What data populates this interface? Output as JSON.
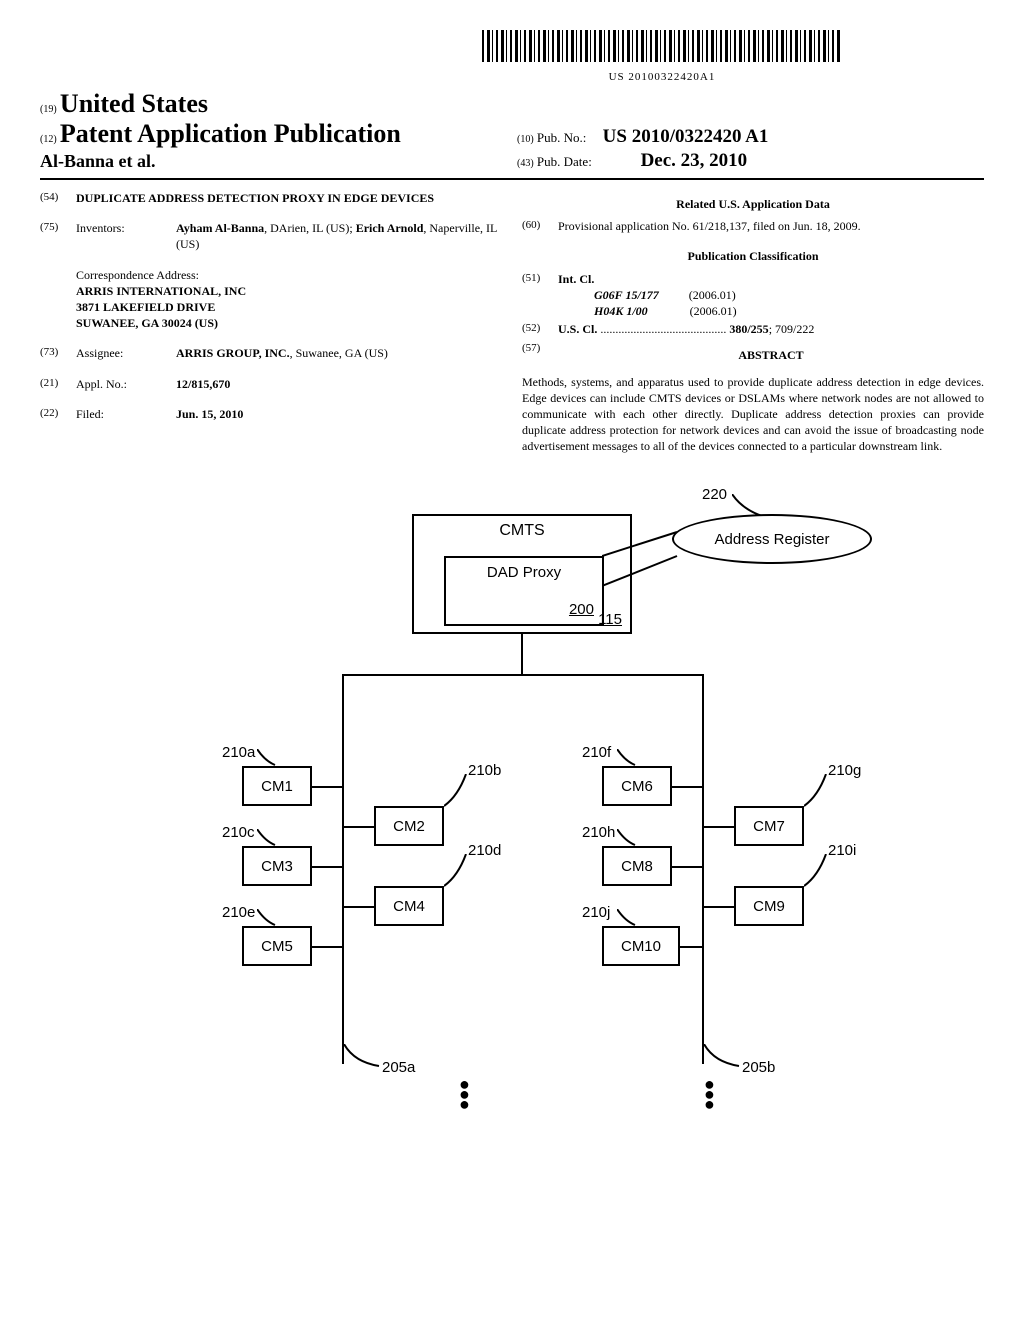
{
  "barcode_text": "US 20100322420A1",
  "header": {
    "country_code": "(19)",
    "country": "United States",
    "pub_type_code": "(12)",
    "pub_type": "Patent Application Publication",
    "authors": "Al-Banna et al.",
    "pub_no_code": "(10)",
    "pub_no_label": "Pub. No.:",
    "pub_no": "US 2010/0322420 A1",
    "pub_date_code": "(43)",
    "pub_date_label": "Pub. Date:",
    "pub_date": "Dec. 23, 2010"
  },
  "left": {
    "title_code": "(54)",
    "title": "DUPLICATE ADDRESS DETECTION PROXY IN EDGE DEVICES",
    "inventors_code": "(75)",
    "inventors_label": "Inventors:",
    "inventors_value_1": "Ayham Al-Banna",
    "inventors_value_1_loc": ", DArien, IL (US); ",
    "inventors_value_2": "Erich Arnold",
    "inventors_value_2_loc": ", Naperville, IL (US)",
    "corr_label": "Correspondence Address:",
    "corr_1": "ARRIS INTERNATIONAL, INC",
    "corr_2": "3871 LAKEFIELD DRIVE",
    "corr_3": "SUWANEE, GA 30024 (US)",
    "assignee_code": "(73)",
    "assignee_label": "Assignee:",
    "assignee_value": "ARRIS GROUP, INC.",
    "assignee_loc": ", Suwanee, GA (US)",
    "appl_code": "(21)",
    "appl_label": "Appl. No.:",
    "appl_value": "12/815,670",
    "filed_code": "(22)",
    "filed_label": "Filed:",
    "filed_value": "Jun. 15, 2010"
  },
  "right": {
    "related_heading": "Related U.S. Application Data",
    "provisional_code": "(60)",
    "provisional_text": "Provisional application No. 61/218,137, filed on Jun. 18, 2009.",
    "class_heading": "Publication Classification",
    "intcl_code": "(51)",
    "intcl_label": "Int. Cl.",
    "intcl_1_sym": "G06F 15/177",
    "intcl_1_ver": "(2006.01)",
    "intcl_2_sym": "H04K 1/00",
    "intcl_2_ver": "(2006.01)",
    "uscl_code": "(52)",
    "uscl_label": "U.S. Cl.",
    "uscl_dots": "..........................................",
    "uscl_value_bold": "380/255",
    "uscl_value_rest": "; 709/222",
    "abstract_code": "(57)",
    "abstract_label": "ABSTRACT",
    "abstract_text": "Methods, systems, and apparatus used to provide duplicate address detection in edge devices. Edge devices can include CMTS devices or DSLAMs where network nodes are not allowed to communicate with each other directly. Duplicate address detection proxies can provide duplicate address protection for network devices and can avoid the issue of broadcasting node advertisement messages to all of the devices connected to a particular downstream link."
  },
  "diagram": {
    "cmts": "CMTS",
    "dad": "DAD Proxy",
    "dad_num": "200",
    "cmts_num": "115",
    "register": "Address Register",
    "register_ref": "220",
    "bus_a_ref": "205a",
    "bus_b_ref": "205b",
    "cm": {
      "a": {
        "label": "CM1",
        "ref": "210a"
      },
      "b": {
        "label": "CM2",
        "ref": "210b"
      },
      "c": {
        "label": "CM3",
        "ref": "210c"
      },
      "d": {
        "label": "CM4",
        "ref": "210d"
      },
      "e": {
        "label": "CM5",
        "ref": "210e"
      },
      "f": {
        "label": "CM6",
        "ref": "210f"
      },
      "g": {
        "label": "CM7",
        "ref": "210g"
      },
      "h": {
        "label": "CM8",
        "ref": "210h"
      },
      "i": {
        "label": "CM9",
        "ref": "210i"
      },
      "j": {
        "label": "CM10",
        "ref": "210j"
      }
    }
  }
}
